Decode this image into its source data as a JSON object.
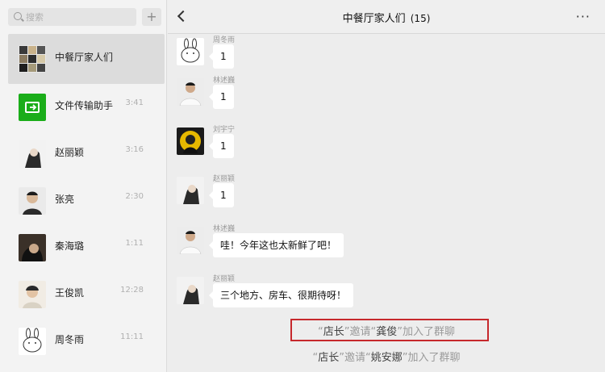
{
  "search": {
    "placeholder": "搜索"
  },
  "add_label": "+",
  "chats": [
    {
      "name": "中餐厅家人们",
      "time": ""
    },
    {
      "name": "文件传输助手",
      "time": "3:41"
    },
    {
      "name": "赵丽颖",
      "time": "3:16"
    },
    {
      "name": "张亮",
      "time": "2:30"
    },
    {
      "name": "秦海璐",
      "time": "1:11"
    },
    {
      "name": "王俊凯",
      "time": "12:28"
    },
    {
      "name": "周冬雨",
      "time": "11:11"
    }
  ],
  "header": {
    "title": "中餐厅家人们",
    "count": "(15)",
    "more": "···"
  },
  "messages": [
    {
      "sender": "周冬雨",
      "text": "1"
    },
    {
      "sender": "林述巍",
      "text": "1"
    },
    {
      "sender": "刘宇宁",
      "text": "1"
    },
    {
      "sender": "赵丽颖",
      "text": "1"
    },
    {
      "sender": "林述巍",
      "text": "哇！今年这也太新鲜了吧！"
    },
    {
      "sender": "赵丽颖",
      "text": "三个地方、房车、很期待呀！"
    }
  ],
  "system_messages": [
    {
      "q1": "“",
      "inviter": "店长",
      "q2": "”邀请“",
      "invitee": "龚俊",
      "q3": "”加入了群聊"
    },
    {
      "q1": "“",
      "inviter": "店长",
      "q2": "”邀请“",
      "invitee": "姚安娜",
      "q3": "”加入了群聊"
    }
  ],
  "colors": {
    "highlight_box": "#c6282c",
    "file_helper_green": "#1aad19"
  }
}
